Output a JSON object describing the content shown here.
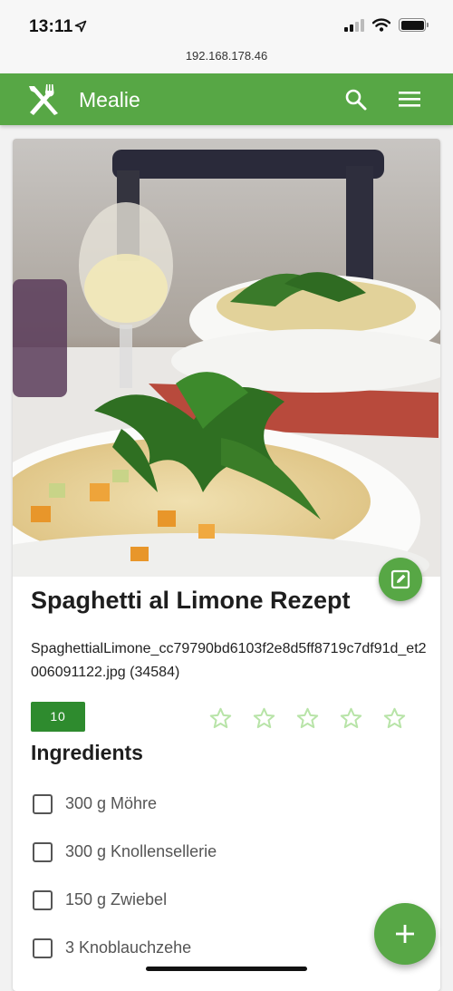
{
  "status_bar": {
    "time": "13:11"
  },
  "browser": {
    "url": "192.168.178.46"
  },
  "app_bar": {
    "title": "Mealie",
    "logo_icon": "fork-knife-icon",
    "search_icon": "search-icon",
    "menu_icon": "hamburger-menu-icon"
  },
  "recipe": {
    "title": "Spaghetti al Limone Rezept",
    "description": "SpaghettialLimone_cc79790bd6103f2e8d5ff8719c7df91d_et2006091122.jpg (34584)",
    "servings": "10",
    "rating": {
      "value": 0,
      "max": 5
    },
    "ingredients_heading": "Ingredients",
    "ingredients": [
      "300 g Möhre",
      "300 g Knollensellerie",
      "150 g Zwiebel",
      "3 Knoblauchzehe"
    ]
  },
  "colors": {
    "primary": "#57a745",
    "badge": "#2e8b2e",
    "star": "#b8e4a8"
  }
}
